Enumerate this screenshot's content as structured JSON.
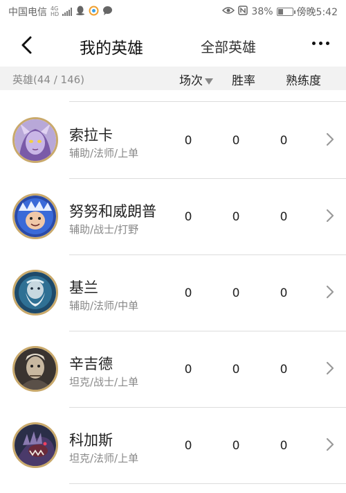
{
  "status_bar": {
    "carrier": "中国电信",
    "net_top": "4G",
    "net_bottom": "HD",
    "battery_percent_text": "38%",
    "battery_level": 0.38,
    "time_text": "傍晚5:42"
  },
  "header": {
    "tab_my": "我的英雄",
    "tab_all": "全部英雄"
  },
  "columns": {
    "count_label": "英雄(44 / 146)",
    "games": "场次",
    "win_rate": "胜率",
    "mastery": "熟练度"
  },
  "heroes": [
    {
      "name": "索拉卡",
      "roles": "辅助/法师/上单",
      "games": "0",
      "win_rate": "0",
      "mastery": "0",
      "avatar_icon": "soraka-portrait"
    },
    {
      "name": "努努和威朗普",
      "roles": "辅助/战士/打野",
      "games": "0",
      "win_rate": "0",
      "mastery": "0",
      "avatar_icon": "nunu-portrait"
    },
    {
      "name": "基兰",
      "roles": "辅助/法师/中单",
      "games": "0",
      "win_rate": "0",
      "mastery": "0",
      "avatar_icon": "zilean-portrait"
    },
    {
      "name": "辛吉德",
      "roles": "坦克/战士/上单",
      "games": "0",
      "win_rate": "0",
      "mastery": "0",
      "avatar_icon": "singed-portrait"
    },
    {
      "name": "科加斯",
      "roles": "坦克/法师/上单",
      "games": "0",
      "win_rate": "0",
      "mastery": "0",
      "avatar_icon": "chogath-portrait"
    }
  ],
  "colors": {
    "avatar_ring": "#c9a96b",
    "header_band": "#f2f2f2",
    "divider": "#dcdcdc"
  }
}
